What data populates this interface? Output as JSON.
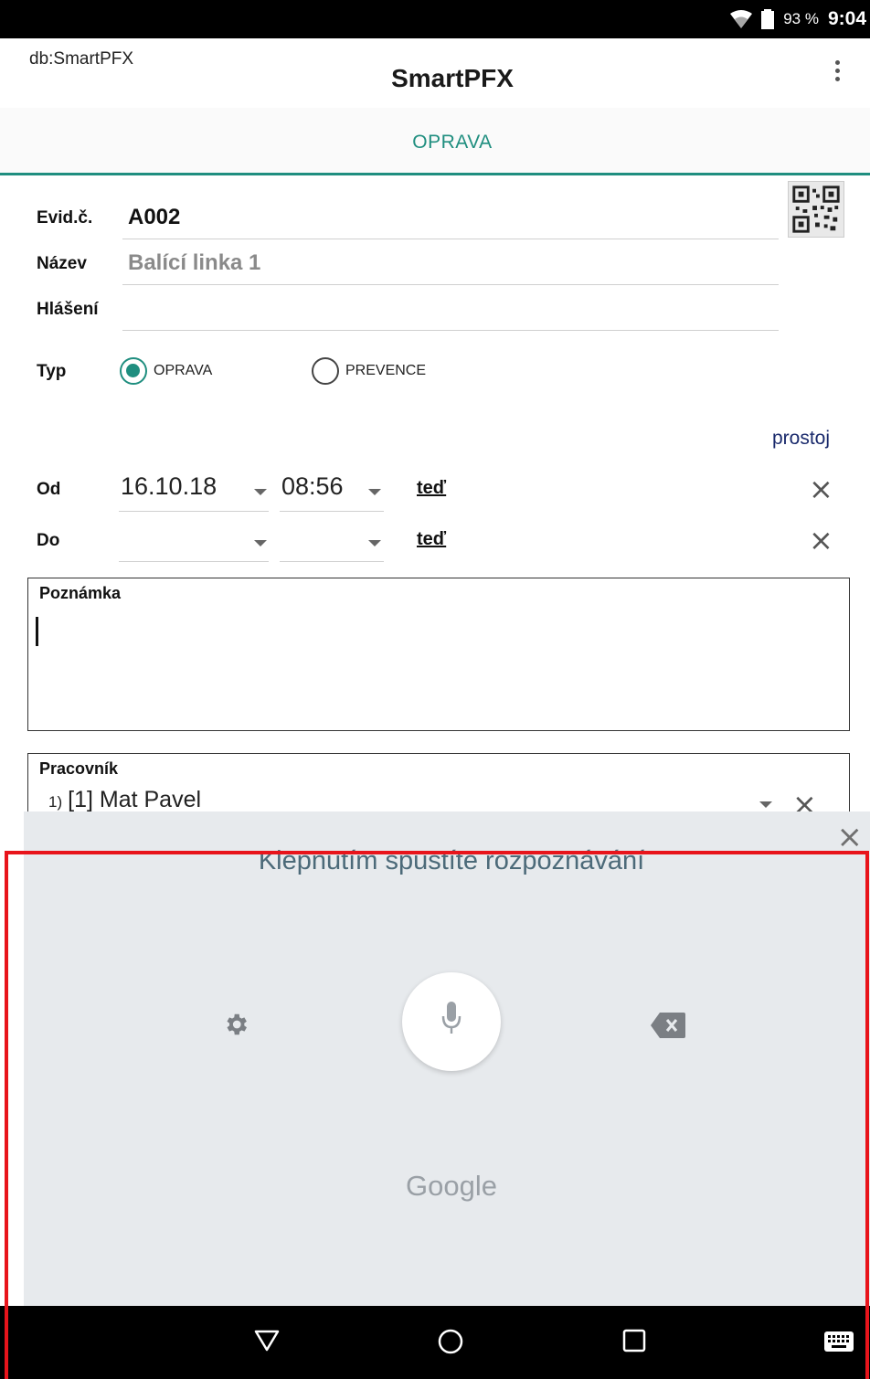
{
  "status_bar": {
    "battery_percent": "93 %",
    "time": "9:04"
  },
  "app_bar": {
    "db_label": "db:SmartPFX",
    "title": "SmartPFX"
  },
  "tabs": [
    {
      "label": "OPRAVA"
    }
  ],
  "form": {
    "evid_label": "Evid.č.",
    "evid_value": "A002",
    "nazev_label": "Název",
    "nazev_value": "Balící linka 1",
    "hlaseni_label": "Hlášení",
    "hlaseni_value": "",
    "typ_label": "Typ",
    "typ_options": [
      {
        "label": "OPRAVA",
        "selected": true
      },
      {
        "label": "PREVENCE",
        "selected": false
      }
    ],
    "prostoj_link": "prostoj",
    "od_label": "Od",
    "od_date": "16.10.18",
    "od_time": "08:56",
    "od_now": "teď",
    "do_label": "Do",
    "do_date": "",
    "do_time": "",
    "do_now": "teď",
    "poznamka_label": "Poznámka",
    "pracovnik_label": "Pracovník",
    "pracovnik_items": [
      {
        "num": "1)",
        "name": "[1] Mat Pavel"
      }
    ]
  },
  "voice_input": {
    "prompt": "Klepnutím spustíte rozpoznávání",
    "brand": "Google",
    "icons": [
      "gear-icon",
      "microphone-icon",
      "backspace-icon",
      "close-icon"
    ]
  },
  "nav_bar": {
    "icons": [
      "back-icon",
      "home-icon",
      "recents-icon",
      "keyboard-icon"
    ]
  },
  "colors": {
    "accent": "#1f8e7f",
    "voice_panel_bg": "#e7eaed",
    "highlight": "#e8141b",
    "link": "#1a2a6c"
  }
}
